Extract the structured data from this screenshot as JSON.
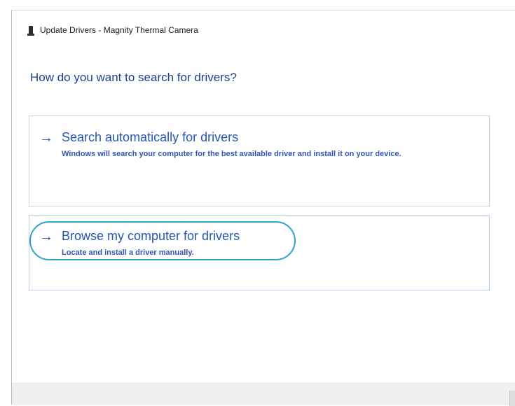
{
  "window": {
    "title": "Update Drivers - Magnity Thermal Camera",
    "title_icon": "device-icon"
  },
  "heading": "How do you want to search for drivers?",
  "options": [
    {
      "icon": "arrow-right-icon",
      "arrow_glyph": "→",
      "title": "Search automatically for drivers",
      "description": "Windows will search your computer for the best available driver and install it on your device."
    },
    {
      "icon": "arrow-right-icon",
      "arrow_glyph": "→",
      "title": "Browse my computer for drivers",
      "description": "Locate and install a driver manually.",
      "highlighted": true
    }
  ],
  "colors": {
    "heading": "#1e3f91",
    "link": "#2456b8",
    "highlight_ring": "#2ea3cf",
    "footer": "#f0f0f0"
  }
}
